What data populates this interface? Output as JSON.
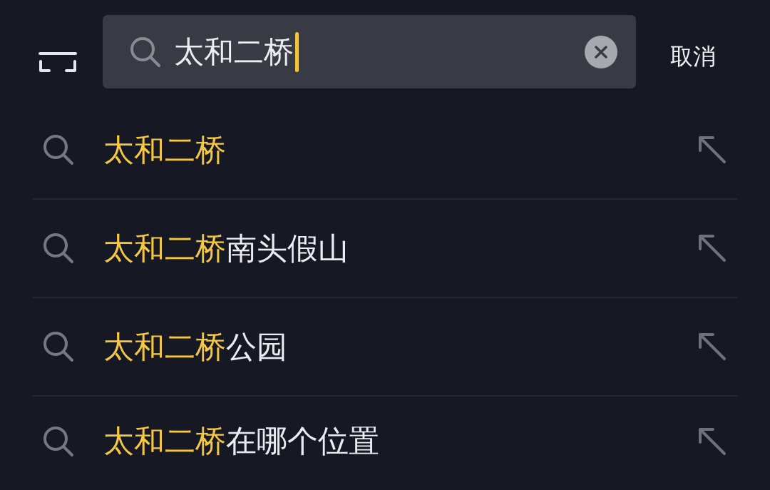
{
  "search": {
    "value": "太和二桥",
    "focused": true
  },
  "cancel": "取消",
  "suggestions": [
    {
      "match": "太和二桥"
    },
    {
      "match": "太和二桥",
      "rest": "南头假山"
    },
    {
      "match": "太和二桥",
      "rest": "公园"
    },
    {
      "match": "太和二桥",
      "rest": "在哪个位置"
    }
  ]
}
